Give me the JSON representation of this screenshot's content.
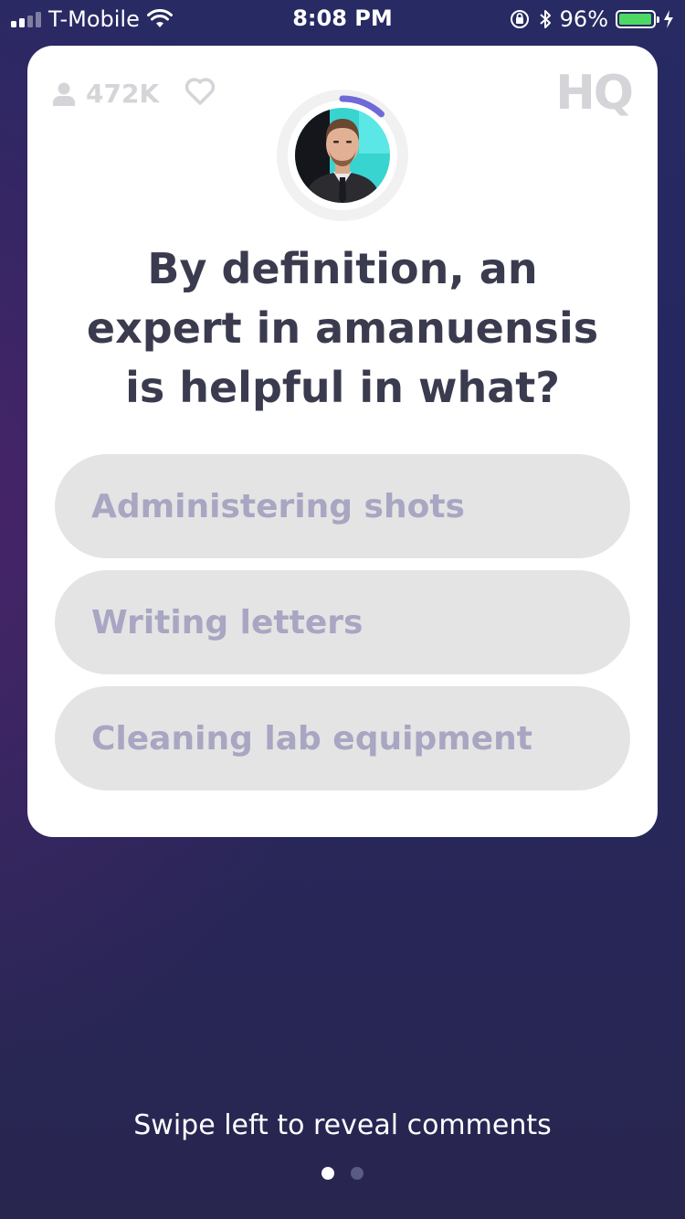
{
  "status_bar": {
    "carrier": "T-Mobile",
    "time": "8:08 PM",
    "battery_percent": "96%",
    "battery_level": 0.96,
    "icons": [
      "signal-icon",
      "wifi-icon",
      "orientation-lock-icon",
      "bluetooth-icon",
      "battery-icon",
      "charging-icon"
    ]
  },
  "card": {
    "viewer_count": "472K",
    "logo": "HQ",
    "timer_progress": 0.12,
    "question": "By definition, an expert in amanuensis is helpful in what?",
    "answers": [
      "Administering shots",
      "Writing letters",
      "Cleaning lab equipment"
    ]
  },
  "footer": {
    "swipe_hint": "Swipe left to reveal comments",
    "page_count": 2,
    "active_page": 1
  },
  "colors": {
    "background": "#262862",
    "card": "#ffffff",
    "question_text": "#3b3b4f",
    "answer_bg": "#e4e4e4",
    "answer_text": "#a8a6c2",
    "timer_accent": "#6e6ad8",
    "battery": "#4cd964"
  }
}
